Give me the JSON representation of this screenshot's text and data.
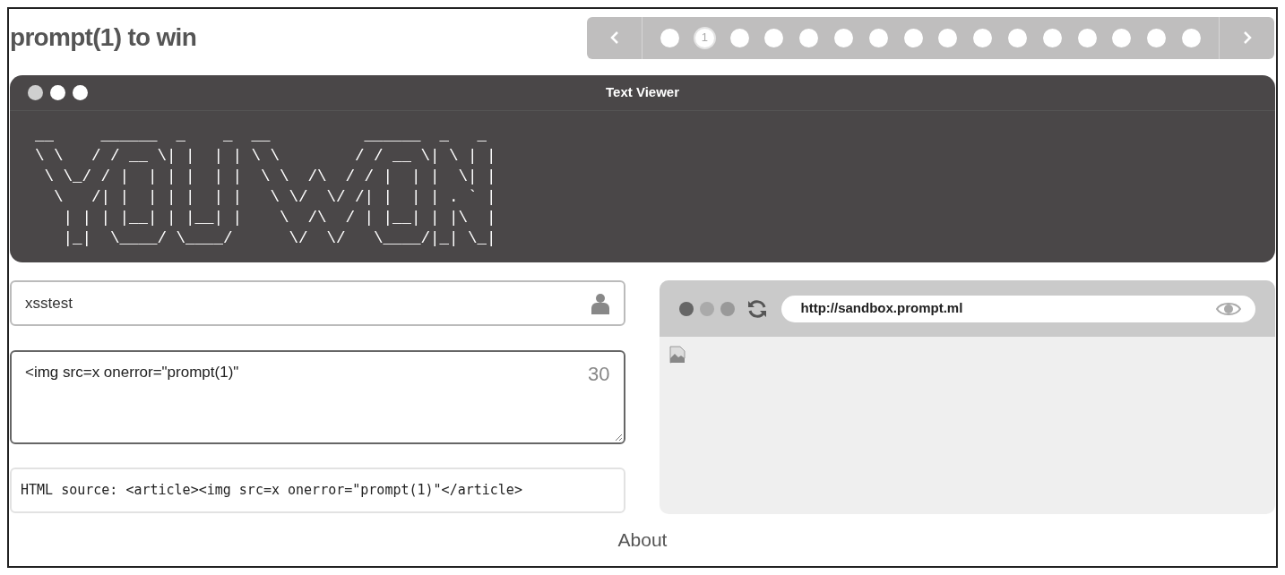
{
  "title": "prompt(1) to win",
  "pager": {
    "pages": [
      {
        "selected": false
      },
      {
        "label": "1",
        "selected": true
      },
      {
        "selected": false
      },
      {
        "selected": false
      },
      {
        "selected": false
      },
      {
        "selected": false
      },
      {
        "selected": false
      },
      {
        "selected": false
      },
      {
        "selected": false
      },
      {
        "selected": false
      },
      {
        "selected": false
      },
      {
        "selected": false
      },
      {
        "selected": false
      },
      {
        "selected": false
      },
      {
        "selected": false
      },
      {
        "selected": false
      }
    ]
  },
  "text_viewer": {
    "title": "Text Viewer",
    "content": "__     ______  _    _  __          ______  _   _ \n\\ \\   / / __ \\| |  | | \\ \\        / / __ \\| \\ | |\n \\ \\_/ / |  | | |  | |  \\ \\  /\\  / / |  | |  \\| |\n  \\   /| |  | | |  | |   \\ \\/  \\/ /| |  | | . ` |\n   | | | |__| | |__| |    \\  /\\  / | |__| | |\\  |\n   |_|  \\____/ \\____/      \\/  \\/   \\____/|_| \\_|"
  },
  "name_field": {
    "value": "xsstest"
  },
  "payload_field": {
    "value": "<img src=x onerror=\"prompt(1)\"",
    "count": "30"
  },
  "html_source": "HTML source: <article><img src=x onerror=\"prompt(1)\"</article>",
  "browser": {
    "url": "http://sandbox.prompt.ml"
  },
  "footer_link": "About"
}
